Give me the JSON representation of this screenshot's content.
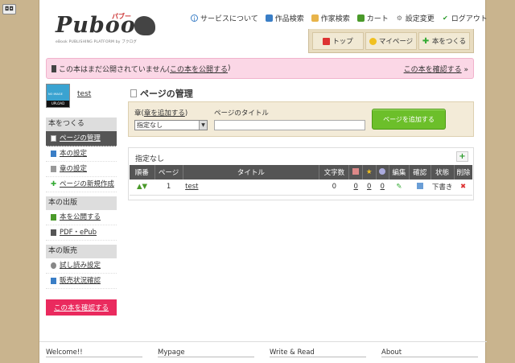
{
  "header": {
    "logo_text": "Puboo",
    "logo_kana": "パブー",
    "logo_sub": "eBook PUBLISHING PLATFORM by ブクログ",
    "nav": [
      {
        "label": "サービスについて",
        "icon": "info-icon"
      },
      {
        "label": "作品検索",
        "icon": "book-icon"
      },
      {
        "label": "作家検索",
        "icon": "person-icon"
      },
      {
        "label": "カート",
        "icon": "cart-icon"
      },
      {
        "label": "設定変更",
        "icon": "gear-icon"
      },
      {
        "label": "ログアウト",
        "icon": "check-icon"
      }
    ],
    "tabs": [
      {
        "label": "トップ",
        "icon": "home-icon"
      },
      {
        "label": "マイページ",
        "icon": "smile-icon"
      },
      {
        "label": "本をつくる",
        "icon": "plus-icon"
      }
    ]
  },
  "alert": {
    "text_before": "この本はまだ公開されていません(",
    "link": "この本を公開する",
    "text_after": ")",
    "right_link": "この本を確認する",
    "right_arrow": "»"
  },
  "user": {
    "name": "test",
    "avatar_top": "NO IMAGE",
    "avatar_bar": "UPLOAD"
  },
  "sidebar": {
    "sections": [
      {
        "header": "本をつくる",
        "items": [
          {
            "label": "ページの管理",
            "active": true
          },
          {
            "label": "本の設定"
          },
          {
            "label": "章の設定"
          },
          {
            "label": "ページの新規作成"
          }
        ]
      },
      {
        "header": "本の出版",
        "items": [
          {
            "label": "本を公開する"
          },
          {
            "label": "PDF・ePub"
          }
        ]
      },
      {
        "header": "本の販売",
        "items": [
          {
            "label": "試し読み設定"
          },
          {
            "label": "販売状況確認"
          }
        ]
      }
    ],
    "confirm_button": "この本を確認する"
  },
  "main": {
    "title": "ページの管理",
    "form": {
      "chapter_label": "章(",
      "chapter_link": "章を追加する",
      "chapter_label_end": ")",
      "title_label": "ページのタイトル",
      "chapter_select": "指定なし",
      "title_value": "",
      "add_button": "ページを追加する"
    },
    "table_caption": "指定なし",
    "plus_label": "+",
    "columns": [
      "順番",
      "ページ",
      "タイトル",
      "文字数",
      "",
      "",
      "",
      "編集",
      "確認",
      "状態",
      "削除"
    ],
    "rows": [
      {
        "page": "1",
        "title": "test",
        "chars": "0",
        "c1": "0",
        "c2": "0",
        "c3": "0",
        "status": "下書き"
      }
    ]
  },
  "footer": [
    "Welcome!!",
    "Mypage",
    "Write & Read",
    "About"
  ],
  "colors": {
    "background": "#c9b48e",
    "alert_bg": "#fbd7e6",
    "sidebar_active": "#555555",
    "confirm_button": "#ea2a5e",
    "add_button": "#6cbf2a"
  }
}
